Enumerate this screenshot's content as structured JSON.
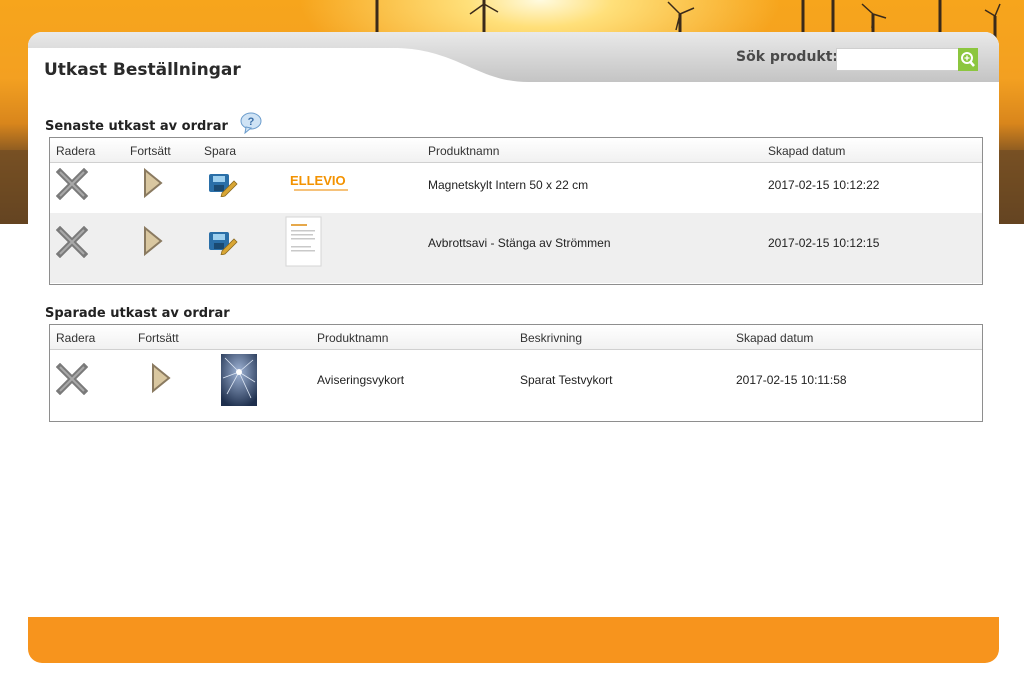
{
  "page": {
    "title": "Utkast Beställningar"
  },
  "search": {
    "label": "Sök produkt:",
    "value": "",
    "placeholder": ""
  },
  "recent_drafts": {
    "title": "Senaste utkast av ordrar",
    "columns": [
      "Radera",
      "Fortsätt",
      "Spara",
      "",
      "Produktnamn",
      "Skapad datum"
    ],
    "rows": [
      {
        "thumbnail": "ELLEVIO",
        "product_name": "Magnetskylt Intern 50 x 22 cm",
        "created": "2017-02-15 10:12:22"
      },
      {
        "thumbnail": "",
        "product_name": "Avbrottsavi - Stänga av Strömmen",
        "created": "2017-02-15 10:12:15"
      }
    ]
  },
  "saved_drafts": {
    "title": "Sparade utkast av ordrar",
    "columns": [
      "Radera",
      "Fortsätt",
      "",
      "Produktnamn",
      "Beskrivning",
      "Skapad datum"
    ],
    "rows": [
      {
        "product_name": "Aviseringsvykort",
        "description": "Sparat Testvykort",
        "created": "2017-02-15 10:11:58"
      }
    ]
  },
  "icons": {
    "delete": "delete-x-icon",
    "continue": "play-arrow-icon",
    "save": "save-disk-icon",
    "help": "help-bubble-icon",
    "search": "search-icon"
  },
  "colors": {
    "accent_orange": "#f7941d",
    "search_green": "#8cc63f",
    "ellevio_orange": "#f39200"
  }
}
